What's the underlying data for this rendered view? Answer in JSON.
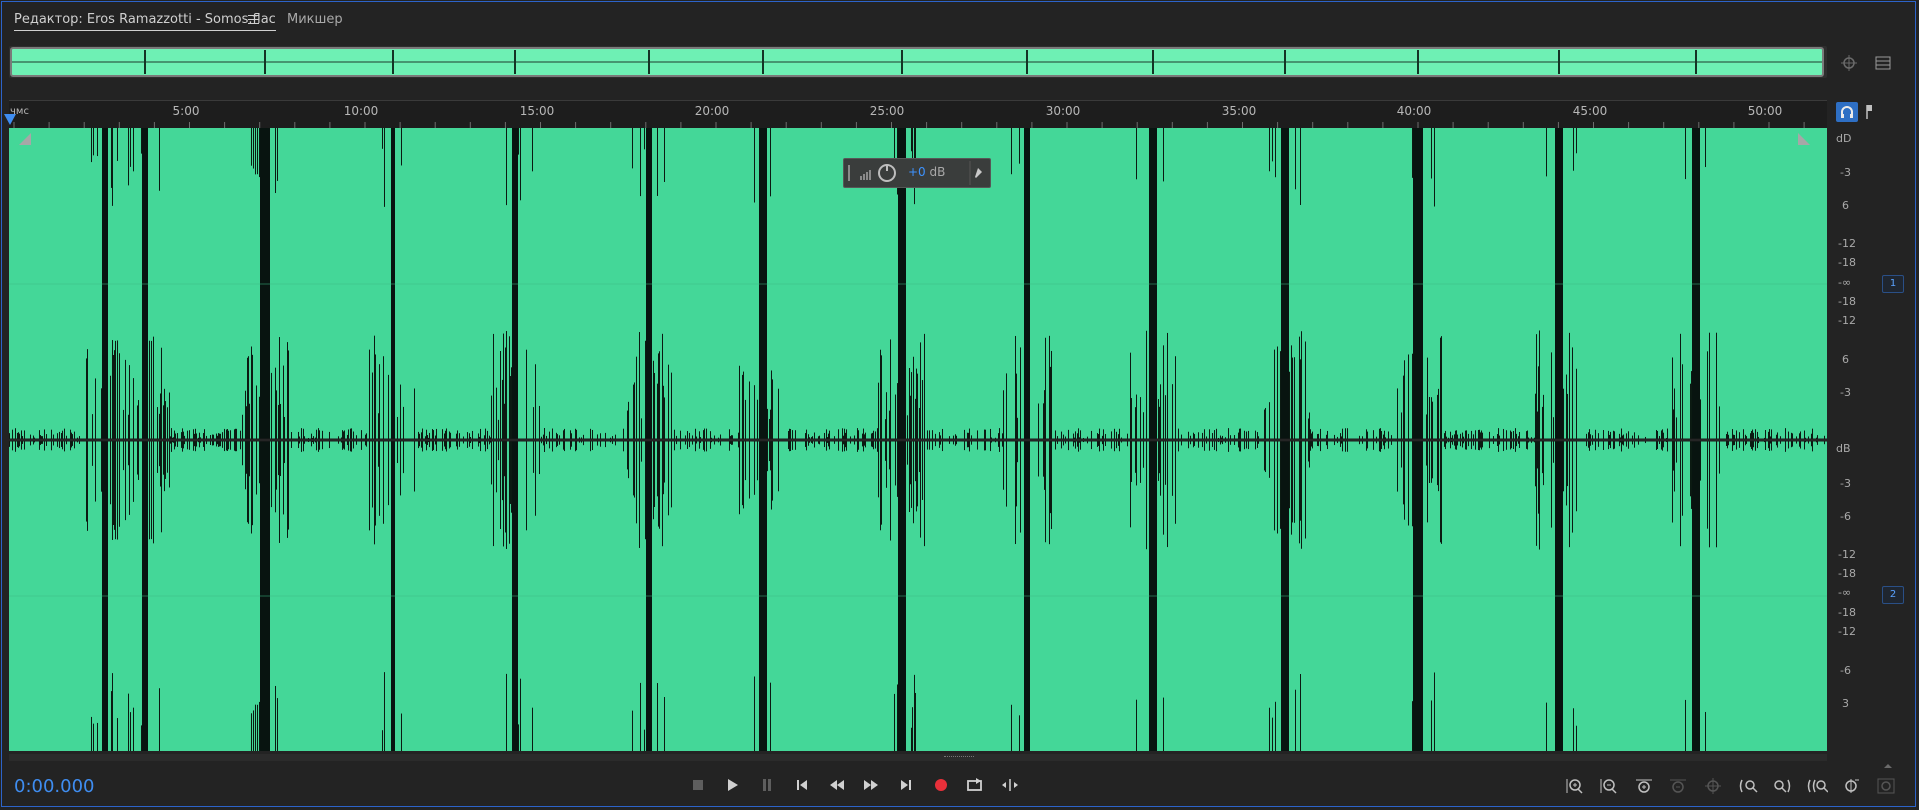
{
  "tabs": {
    "editor_label": "Редактор: Eros Ramazzotti - Somos.flac",
    "mixer_label": "Микшер"
  },
  "ruler": {
    "unit": "чмс",
    "labels": [
      "5:00",
      "10:00",
      "15:00",
      "20:00",
      "25:00",
      "30:00",
      "35:00",
      "40:00",
      "45:00",
      "50:00"
    ]
  },
  "hud": {
    "value": "+0",
    "unit": "dB"
  },
  "db_scale": {
    "channel1": [
      "dD",
      "-3",
      "6",
      "-12",
      "-18",
      "-∞",
      "-18",
      "-12",
      "6",
      "-3"
    ],
    "channel2": [
      "dB",
      "-3",
      "-6",
      "-12",
      "-18",
      "-∞",
      "-18",
      "-12",
      "-6",
      "3"
    ],
    "channel_badges": [
      "1",
      "2"
    ]
  },
  "transport": {
    "timecode": "0:00.000",
    "buttons": [
      "stop",
      "play",
      "pause",
      "go-to-start",
      "rewind",
      "fast-forward",
      "go-to-end",
      "record",
      "loop",
      "skip-selection"
    ]
  },
  "colors": {
    "waveform": "#44d798",
    "overview": "#6ef0b4",
    "accent": "#3f8df0",
    "record": "#e8303a"
  }
}
